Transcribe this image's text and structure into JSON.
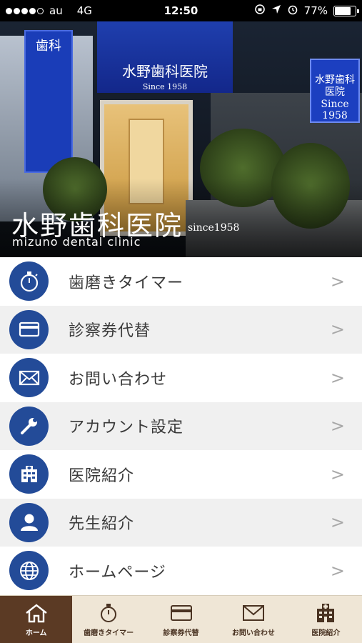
{
  "status_bar": {
    "carrier": "au",
    "network": "4G",
    "time": "12:50",
    "battery": "77%",
    "battery_level": 0.77,
    "signal_bars": 4
  },
  "hero": {
    "title": "水野歯科医院",
    "since": "since1958",
    "subtitle": "mizuno dental clinic",
    "sign_vertical": "歯科",
    "awning_title": "水野歯科医院",
    "awning_since": "Since 1958",
    "sign_right": "水野歯科医院 Since 1958"
  },
  "menu": {
    "items": [
      {
        "label": "歯磨きタイマー",
        "icon": "stopwatch-icon"
      },
      {
        "label": "診察券代替",
        "icon": "card-icon"
      },
      {
        "label": "お問い合わせ",
        "icon": "mail-icon"
      },
      {
        "label": "アカウント設定",
        "icon": "wrench-icon"
      },
      {
        "label": "医院紹介",
        "icon": "building-icon"
      },
      {
        "label": "先生紹介",
        "icon": "person-icon"
      },
      {
        "label": "ホームページ",
        "icon": "globe-icon"
      }
    ],
    "chevron": ">"
  },
  "tab_bar": {
    "tabs": [
      {
        "label": "ホーム",
        "icon": "home-icon",
        "active": true
      },
      {
        "label": "歯磨きタイマー",
        "icon": "stopwatch-icon",
        "active": false
      },
      {
        "label": "診察券代替",
        "icon": "card-icon",
        "active": false
      },
      {
        "label": "お問い合わせ",
        "icon": "mail-icon",
        "active": false
      },
      {
        "label": "医院紹介",
        "icon": "building-icon",
        "active": false
      }
    ]
  },
  "colors": {
    "icon_circle": "#234b98",
    "tab_bar_bg": "#efe6d6",
    "tab_active_bg": "#5b3a24",
    "menu_text": "#3a3a3a",
    "chevron": "#a8a8a8"
  }
}
